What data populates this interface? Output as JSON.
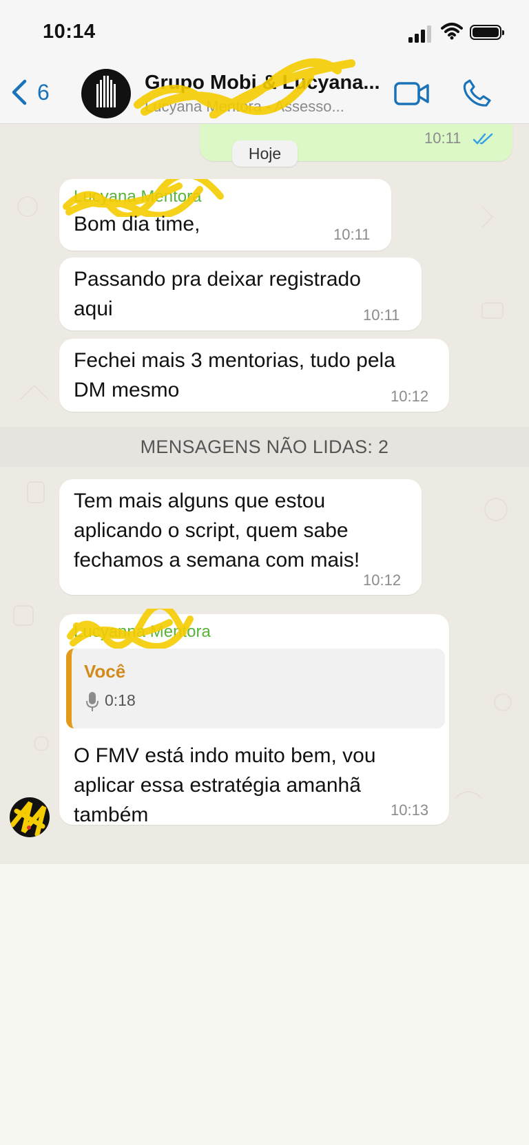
{
  "status_bar": {
    "time": "10:14"
  },
  "header": {
    "back_count": "6",
    "title": "Grupo Mobi & Lucyana...",
    "subtitle": "Lucyana Mentora - Assesso..."
  },
  "chat": {
    "date_label": "Hoje",
    "outgoing_time": "10:11",
    "unread_label": "MENSAGENS NÃO LIDAS: 2",
    "messages": [
      {
        "sender": "Lucyana Mentora",
        "text": "Bom dia time,",
        "time": "10:11"
      },
      {
        "line1": "Passando pra deixar registrado",
        "line2": "aqui",
        "time": "10:11"
      },
      {
        "line1": "Fechei mais 3 mentorias, tudo pela",
        "line2": "DM mesmo",
        "time": "10:12"
      },
      {
        "line1": "Tem mais alguns que estou",
        "line2": "aplicando o script, quem sabe",
        "line3": "fechamos a semana com mais!",
        "time": "10:12"
      },
      {
        "sender": "Lucyanna Mentora",
        "quote_sender": "Você",
        "quote_duration": "0:18",
        "line1": "O FMV está indo muito bem, vou",
        "line2": "aplicar essa estratégia amanhã",
        "line3": "também",
        "time": "10:13"
      }
    ]
  },
  "colors": {
    "accent_blue": "#1a73b8",
    "sender_green": "#58b33a",
    "quote_orange": "#e39a1a",
    "outgoing_bubble": "#dcf8c6",
    "chat_background": "#ede9e3",
    "read_ticks": "#34a0e6"
  },
  "icons": [
    "back-chevron-icon",
    "video-call-icon",
    "phone-call-icon",
    "signal-icon",
    "wifi-icon",
    "battery-icon",
    "double-check-icon",
    "microphone-icon"
  ]
}
